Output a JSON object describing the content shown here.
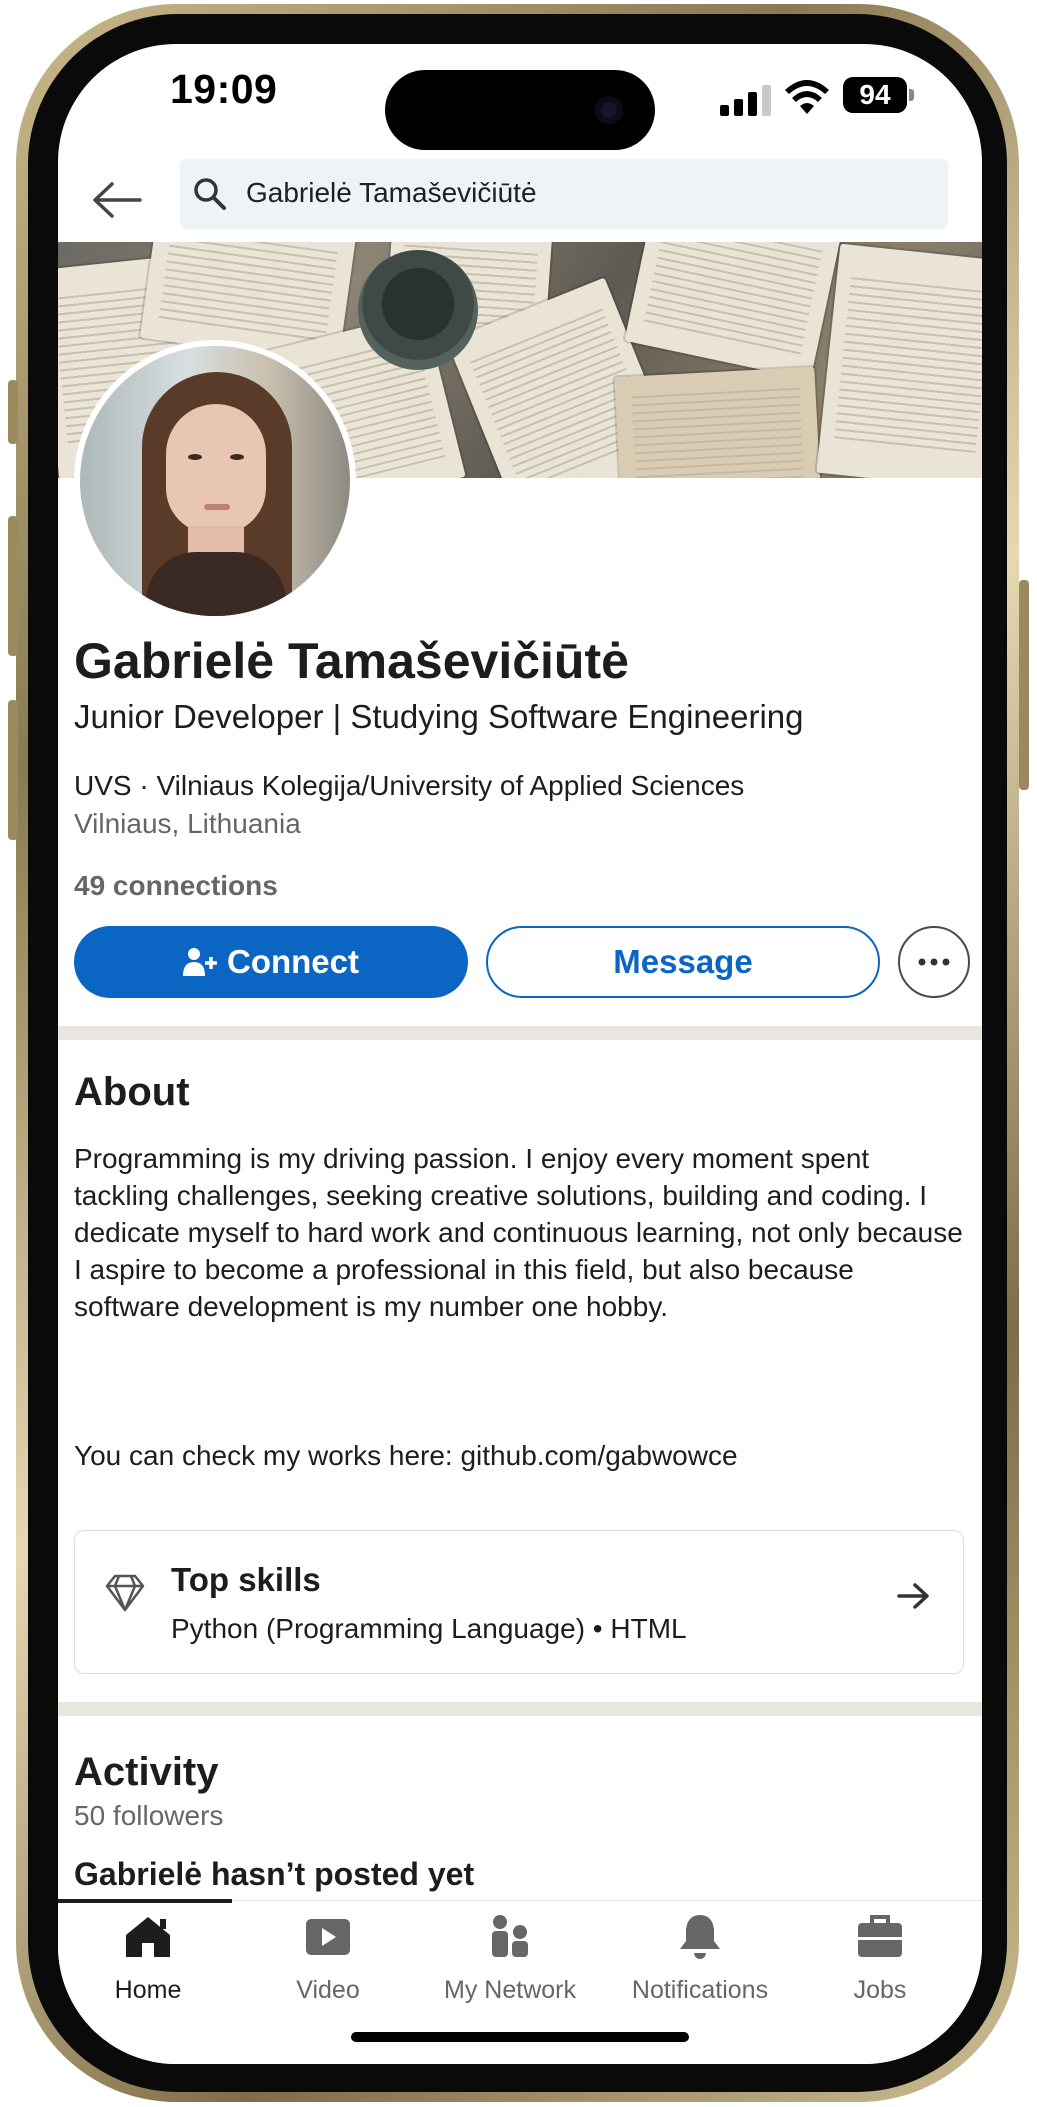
{
  "status_bar": {
    "time": "19:09",
    "battery": "94"
  },
  "search": {
    "query": "Gabrielė Tamaševičiūtė"
  },
  "profile": {
    "name": "Gabrielė Tamaševičiūtė",
    "headline": "Junior Developer | Studying Software Engineering",
    "education": "UVS · Vilniaus Kolegija/University of Applied Sciences",
    "location": "Vilniaus, Lithuania",
    "connections": "49 connections"
  },
  "actions": {
    "connect_label": "Connect",
    "message_label": "Message"
  },
  "about": {
    "title": "About",
    "body": "Programming is my driving passion. I enjoy every moment spent tackling challenges, seeking creative solutions, building and coding. I dedicate myself to hard work and continuous learning, not only because I aspire to become a professional in this field, but also because software development is my number one hobby.",
    "link_line": "You can check my works here: github.com/gabwowce"
  },
  "top_skills": {
    "title": "Top skills",
    "skills": "Python (Programming Language) • HTML"
  },
  "activity": {
    "title": "Activity",
    "followers": "50 followers",
    "empty_message": "Gabrielė hasn’t posted yet"
  },
  "bottom_nav": {
    "items": [
      {
        "label": "Home",
        "icon": "home-icon",
        "active": true
      },
      {
        "label": "Video",
        "icon": "video-icon",
        "active": false
      },
      {
        "label": "My Network",
        "icon": "network-icon",
        "active": false
      },
      {
        "label": "Notifications",
        "icon": "bell-icon",
        "active": false
      },
      {
        "label": "Jobs",
        "icon": "briefcase-icon",
        "active": false
      }
    ]
  },
  "colors": {
    "accent": "#0a66c2",
    "divider": "#e8e6df",
    "text": "#1d1d1d",
    "muted": "#666666"
  }
}
